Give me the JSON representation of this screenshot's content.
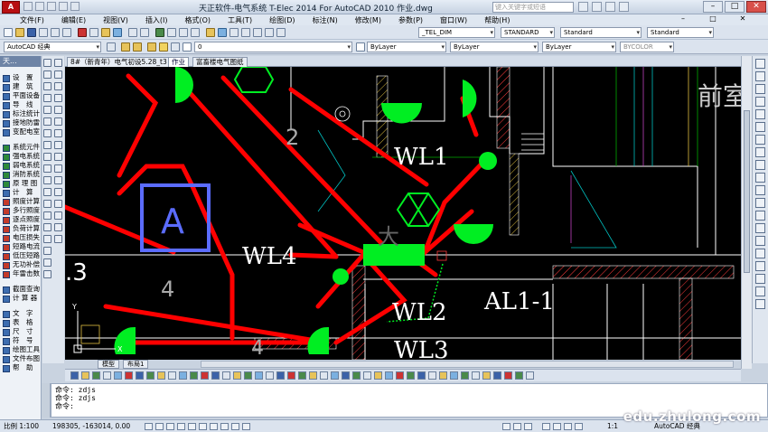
{
  "window": {
    "title": "天正软件-电气系统 T-Elec 2014  For AutoCAD 2010       作业.dwg",
    "search_placeholder": "键入关键字或短语"
  },
  "menu": [
    "文件(F)",
    "编辑(E)",
    "视图(V)",
    "插入(I)",
    "格式(O)",
    "工具(T)",
    "绘图(D)",
    "标注(N)",
    "修改(M)",
    "参数(P)",
    "窗口(W)",
    "帮助(H)"
  ],
  "toolbar": {
    "text_style": "_TEL_DIM",
    "dim_style": "STANDARD",
    "table_style": "Standard",
    "ml_style": "Standard",
    "workspace": "AutoCAD 经典",
    "layer": "0",
    "color": "ByLayer",
    "linetype": "ByLayer",
    "lineweight": "ByLayer",
    "plot_style": "BYCOLOR"
  },
  "left_panel": {
    "title": "天...",
    "items": [
      "设　置",
      "建　筑",
      "平面设备",
      "导　线",
      "标注统计",
      "接地防雷",
      "变配电室",
      "系统元件",
      "强电系统",
      "弱电系统",
      "消防系统",
      "原 理 图",
      "计　算",
      "照度计算",
      "多行照度",
      "逐点照度",
      "负荷计算",
      "电压损失",
      "短路电流",
      "低压短路",
      "无功补偿",
      "年雷击数",
      "截面查询",
      "计 算 器",
      "文　字",
      "表　格",
      "尺　寸",
      "符　号",
      "绘图工具",
      "文件布图",
      "帮　助"
    ]
  },
  "file_tabs": [
    "8#（新青年）电气初设5.28_t3",
    "作业",
    "富畜楼电气图纸"
  ],
  "layout_tabs": [
    "模型",
    "布局1"
  ],
  "drawing": {
    "labels": {
      "wl1": "WL1",
      "wl2": "WL2",
      "wl3": "WL3",
      "wl4": "WL4",
      "al1": "AL1-1",
      "room_a": "A",
      "num_a": "4",
      "num_b": "4",
      "num_c": "2",
      "num_d": ".3",
      "front_room": "前室",
      "hall": "大",
      "axis_y": "Y",
      "axis_x": "X"
    }
  },
  "command": {
    "lines": [
      "命令:  zdjs",
      "命令:  zdjs",
      "命令:"
    ]
  },
  "status": {
    "scale": "比例 1:100",
    "coords": "198305, -163014, 0.00",
    "workspace": "AutoCAD 经典",
    "annot_scale": "1:1"
  },
  "watermark": "edu.zhulong.com",
  "colors": {
    "wire": "#ff0000",
    "device": "#00ee22",
    "wall": "#ffffff",
    "room_box": "#5b6cff",
    "hatch": "#ff3c3c"
  }
}
